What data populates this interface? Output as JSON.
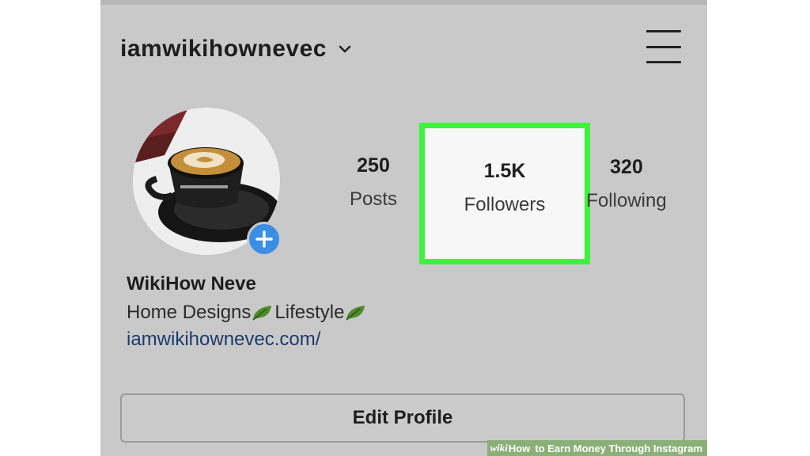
{
  "header": {
    "username": "iamwikihownevec"
  },
  "stats": {
    "posts": {
      "value": "250",
      "label": "Posts"
    },
    "followers": {
      "value": "1.5K",
      "label": "Followers"
    },
    "following": {
      "value": "320",
      "label": "Following"
    }
  },
  "bio": {
    "name": "WikiHow Neve",
    "desc_1": "Home Designs",
    "desc_2": " Lifestyle",
    "link": "iamwikihownevec.com/"
  },
  "actions": {
    "edit_profile": "Edit Profile"
  },
  "watermark": {
    "wiki": "wiki",
    "how": "How",
    "title": "to Earn Money Through Instagram"
  },
  "colors": {
    "highlight": "#3df33a",
    "badge": "#3a8ee6",
    "link": "#1c3a6b"
  },
  "icons": [
    "chevron-down-icon",
    "hamburger-menu-icon",
    "plus-icon",
    "leaf-icon"
  ]
}
